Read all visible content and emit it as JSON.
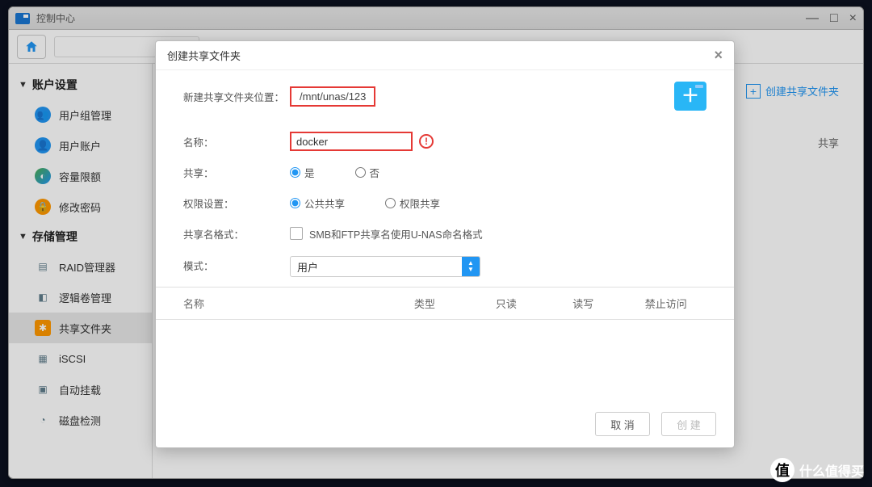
{
  "window": {
    "title": "控制中心"
  },
  "topbar": {
    "create_shared_link": "创建共享文件夹"
  },
  "bg_fragment": "共享",
  "sidebar": {
    "groups": [
      {
        "label": "账户设置",
        "items": [
          {
            "label": "用户组管理",
            "icon": "users",
            "style": "ic-blue"
          },
          {
            "label": "用户账户",
            "icon": "user",
            "style": "ic-blue"
          },
          {
            "label": "容量限额",
            "icon": "quota",
            "style": "ic-teal"
          },
          {
            "label": "修改密码",
            "icon": "lock",
            "style": "ic-orange"
          }
        ]
      },
      {
        "label": "存储管理",
        "items": [
          {
            "label": "RAID管理器",
            "icon": "raid",
            "style": "ic-grey"
          },
          {
            "label": "逻辑卷管理",
            "icon": "volume",
            "style": "ic-grey"
          },
          {
            "label": "共享文件夹",
            "icon": "folder",
            "style": "ic-orange",
            "active": true
          },
          {
            "label": "iSCSI",
            "icon": "iscsi",
            "style": "ic-grey"
          },
          {
            "label": "自动挂载",
            "icon": "mount",
            "style": "ic-grey"
          },
          {
            "label": "磁盘检测",
            "icon": "disk",
            "style": "ic-grey"
          }
        ]
      }
    ]
  },
  "modal": {
    "title": "创建共享文件夹",
    "path_label": "新建共享文件夹位置：",
    "path_value": "/mnt/unas/123",
    "name_label": "名称：",
    "name_value": "docker",
    "share_label": "共享：",
    "share_yes": "是",
    "share_no": "否",
    "perm_label": "权限设置：",
    "perm_public": "公共共享",
    "perm_restricted": "权限共享",
    "namefmt_label": "共享名格式：",
    "namefmt_desc": "SMB和FTP共享名使用U-NAS命名格式",
    "mode_label": "模式：",
    "mode_value": "用户",
    "columns": {
      "name": "名称",
      "type": "类型",
      "readonly": "只读",
      "readwrite": "读写",
      "deny": "禁止访问"
    },
    "cancel": "取 消",
    "create": "创 建"
  },
  "watermark": "什么值得买"
}
